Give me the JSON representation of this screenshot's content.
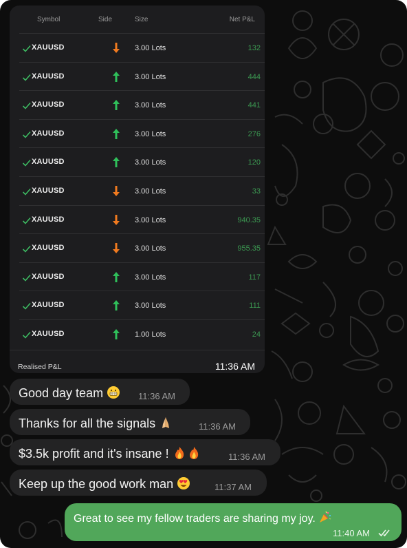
{
  "trades": {
    "headers": {
      "symbol": "Symbol",
      "side": "Side",
      "size": "Size",
      "pnl": "Net P&L"
    },
    "rows": [
      {
        "symbol": "XAUUSD",
        "side": "sell",
        "size": "3.00 Lots",
        "pnl": "132"
      },
      {
        "symbol": "XAUUSD",
        "side": "buy",
        "size": "3.00 Lots",
        "pnl": "444"
      },
      {
        "symbol": "XAUUSD",
        "side": "buy",
        "size": "3.00 Lots",
        "pnl": "441"
      },
      {
        "symbol": "XAUUSD",
        "side": "buy",
        "size": "3.00 Lots",
        "pnl": "276"
      },
      {
        "symbol": "XAUUSD",
        "side": "buy",
        "size": "3.00 Lots",
        "pnl": "120"
      },
      {
        "symbol": "XAUUSD",
        "side": "sell",
        "size": "3.00 Lots",
        "pnl": "33"
      },
      {
        "symbol": "XAUUSD",
        "side": "sell",
        "size": "3.00 Lots",
        "pnl": "940.35"
      },
      {
        "symbol": "XAUUSD",
        "side": "sell",
        "size": "3.00 Lots",
        "pnl": "955.35"
      },
      {
        "symbol": "XAUUSD",
        "side": "buy",
        "size": "3.00 Lots",
        "pnl": "117"
      },
      {
        "symbol": "XAUUSD",
        "side": "buy",
        "size": "3.00 Lots",
        "pnl": "111"
      },
      {
        "symbol": "XAUUSD",
        "side": "buy",
        "size": "1.00 Lots",
        "pnl": "24"
      }
    ],
    "footer_label": "Realised P&L",
    "time": "11:36 AM"
  },
  "messages": [
    {
      "text": "Good day team",
      "emoji": "grimacing-face-icon",
      "time": "11:36 AM"
    },
    {
      "text": "Thanks for all the signals",
      "emoji": "folded-hands-icon",
      "time": "11:36 AM"
    },
    {
      "text": "$3.5k profit and it's insane !",
      "emoji": "fire-icon",
      "time": "11:36 AM"
    },
    {
      "text": "Keep up the good work man",
      "emoji": "heart-eyes-icon",
      "time": "11:37 AM"
    }
  ],
  "outgoing": {
    "text": "Great to see my fellow traders are sharing my joy.",
    "emoji": "party-popper-icon",
    "time": "11:40 AM",
    "status": "read"
  },
  "colors": {
    "buy_arrow": "#2fbf5a",
    "sell_arrow": "#f07a1f",
    "pnl_positive": "#3c9a52",
    "outgoing_bubble": "#51a75a",
    "incoming_bubble": "#232324",
    "check": "#3dbb62"
  }
}
